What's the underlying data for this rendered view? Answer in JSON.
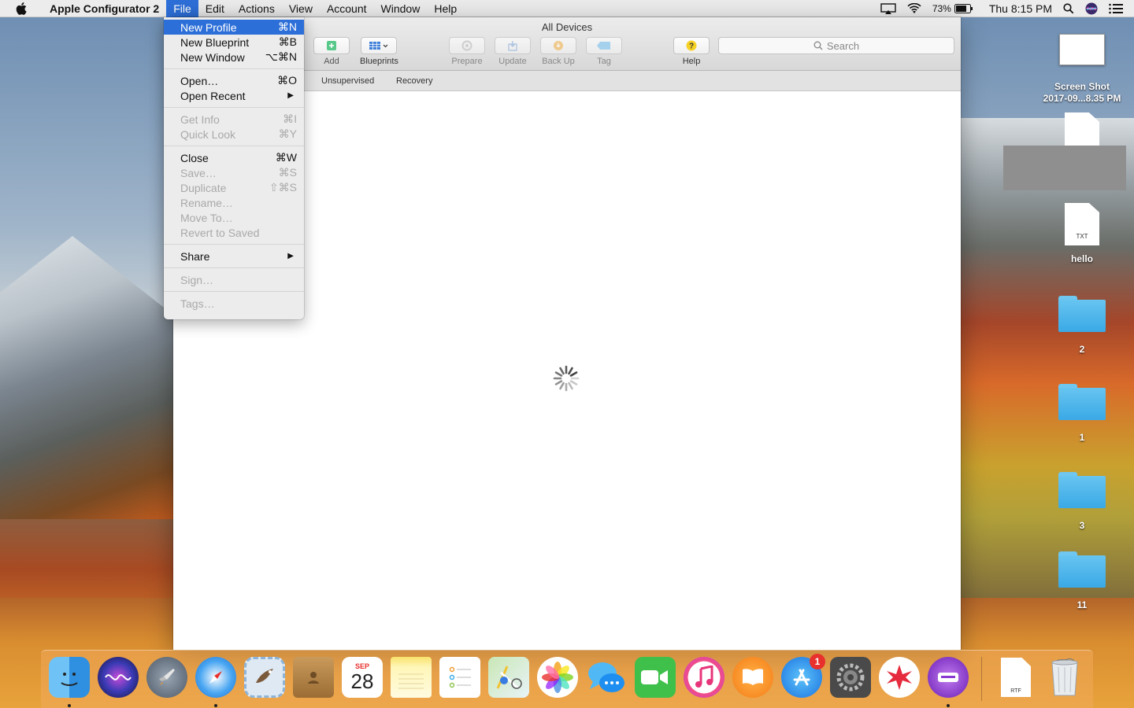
{
  "menubar": {
    "app_name": "Apple Configurator 2",
    "menus": [
      "File",
      "Edit",
      "Actions",
      "View",
      "Account",
      "Window",
      "Help"
    ],
    "battery": "73%",
    "clock": "Thu 8:15 PM"
  },
  "file_menu": {
    "items": [
      {
        "label": "New Profile",
        "shortcut": "⌘N",
        "enabled": true,
        "highlighted": true
      },
      {
        "label": "New Blueprint",
        "shortcut": "⌘B",
        "enabled": true
      },
      {
        "label": "New Window",
        "shortcut": "⌥⌘N",
        "enabled": true
      },
      {
        "label": "Open…",
        "shortcut": "⌘O",
        "enabled": true
      },
      {
        "label": "Open Recent",
        "shortcut": "▶",
        "enabled": true
      },
      {
        "label": "Get Info",
        "shortcut": "⌘I",
        "enabled": false
      },
      {
        "label": "Quick Look",
        "shortcut": "⌘Y",
        "enabled": false
      },
      {
        "label": "Close",
        "shortcut": "⌘W",
        "enabled": true
      },
      {
        "label": "Save…",
        "shortcut": "⌘S",
        "enabled": false
      },
      {
        "label": "Duplicate",
        "shortcut": "⇧⌘S",
        "enabled": false
      },
      {
        "label": "Rename…",
        "shortcut": "",
        "enabled": false
      },
      {
        "label": "Move To…",
        "shortcut": "",
        "enabled": false
      },
      {
        "label": "Revert to Saved",
        "shortcut": "",
        "enabled": false
      },
      {
        "label": "Share",
        "shortcut": "▶",
        "enabled": true
      },
      {
        "label": "Sign…",
        "shortcut": "",
        "enabled": false
      },
      {
        "label": "Tags…",
        "shortcut": "",
        "enabled": false
      }
    ]
  },
  "window": {
    "title": "All Devices",
    "toolbar": {
      "add": "Add",
      "blueprints": "Blueprints",
      "prepare": "Prepare",
      "update": "Update",
      "backup": "Back Up",
      "tag": "Tag",
      "help": "Help",
      "search_placeholder": "Search"
    },
    "tabs": [
      "Unsupervised",
      "Recovery"
    ]
  },
  "desktop": {
    "screenshot_label_1": "Screen Shot",
    "screenshot_label_2": "2017-09...8.35 PM",
    "txt_badge": "TXT",
    "hello": "hello",
    "folders": [
      "2",
      "1",
      "3",
      "11"
    ]
  },
  "dock": {
    "calendar_month": "SEP",
    "calendar_day": "28",
    "appstore_badge": "1",
    "rtf_label": "RTF"
  },
  "colors": {
    "menu_highlight": "#2d6fd8",
    "folder_blue": "#3aa9e6",
    "badge_red": "#e8302c"
  }
}
